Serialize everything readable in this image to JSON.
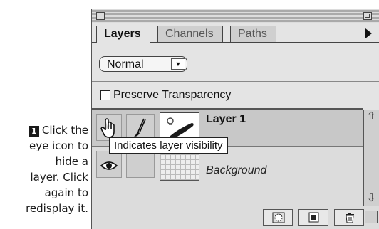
{
  "callout": {
    "step_number": "1",
    "lines": [
      "Click the",
      "eye icon to",
      "hide a",
      "layer. Click",
      "again to",
      "redisplay it."
    ]
  },
  "palette": {
    "tabs": [
      "Layers",
      "Channels",
      "Paths"
    ],
    "blend_mode": "Normal",
    "preserve_transparency_label": "Preserve Transparency",
    "layers": [
      {
        "name": "Layer 1",
        "selected": true
      },
      {
        "name": "Background",
        "selected": false
      }
    ],
    "tooltip": "Indicates layer visibility"
  },
  "icons": {
    "close_box": "close-box-icon",
    "zoom_box": "zoom-box-icon",
    "flyout": "triangle-right-icon",
    "pointer": "hand-pointer-icon",
    "brush": "paintbrush-icon",
    "eye": "eye-icon",
    "mask": "layer-mask-icon",
    "new_layer": "new-layer-icon",
    "trash": "trash-icon",
    "scroll_up": "arrow-up-icon",
    "scroll_down": "arrow-down-icon"
  }
}
